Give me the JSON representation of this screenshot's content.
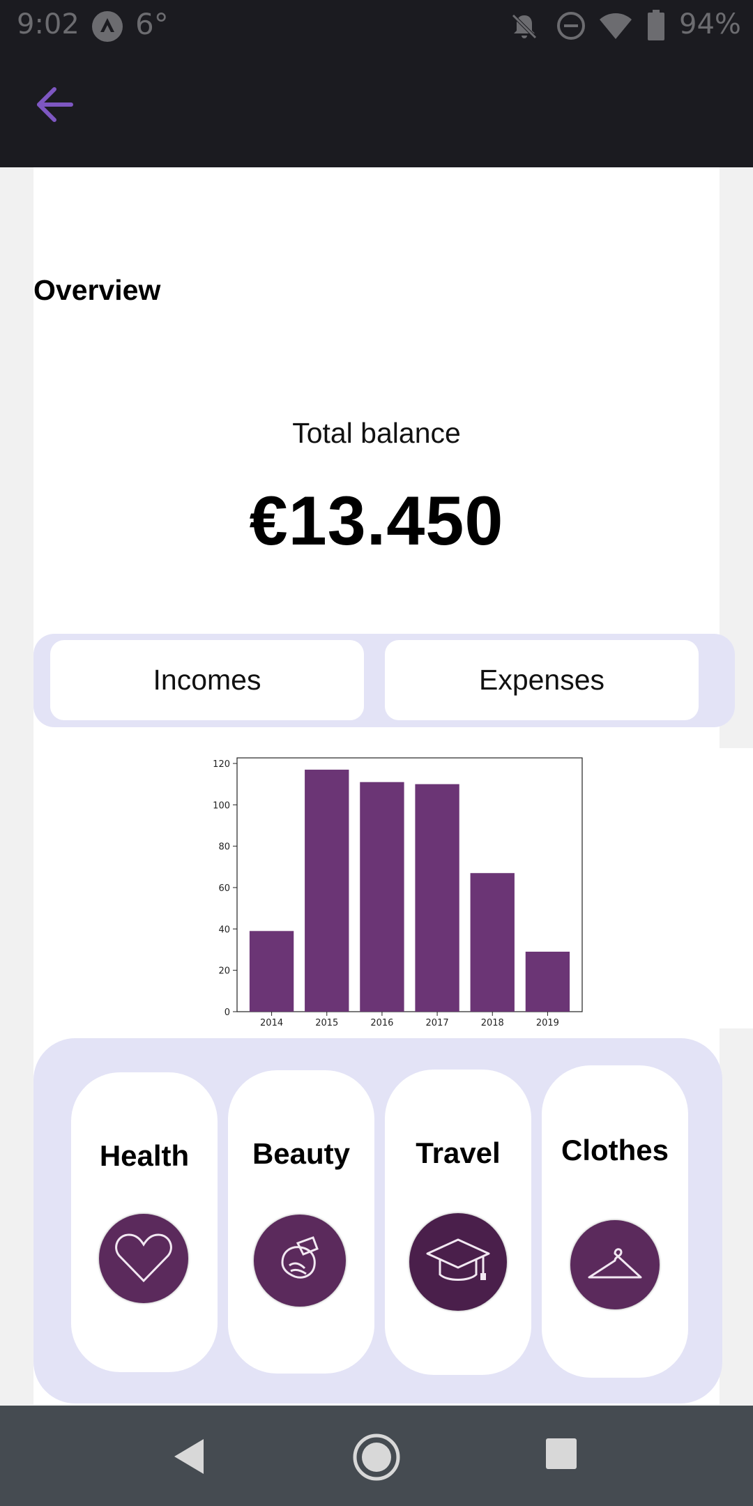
{
  "status_bar": {
    "time": "9:02",
    "temperature": "6°",
    "battery": "94%"
  },
  "toolbar": {
    "back_icon": "arrow-left-icon"
  },
  "overview": {
    "title": "Overview",
    "total_label": "Total balance",
    "total_value": "€13.450"
  },
  "tabs": {
    "incomes": "Incomes",
    "expenses": "Expenses"
  },
  "chart_data": {
    "type": "bar",
    "categories": [
      "2014",
      "2015",
      "2016",
      "2017",
      "2018",
      "2019"
    ],
    "values": [
      39,
      117,
      111,
      110,
      67,
      29
    ],
    "ylim": [
      0,
      120
    ],
    "yticks": [
      0,
      20,
      40,
      60,
      80,
      100,
      120
    ],
    "bar_color": "#6b3575",
    "title": "",
    "xlabel": "",
    "ylabel": ""
  },
  "categories": [
    {
      "label": "Health",
      "icon": "heart-icon"
    },
    {
      "label": "Beauty",
      "icon": "beauty-icon"
    },
    {
      "label": "Travel",
      "icon": "graduation-cap-icon"
    },
    {
      "label": "Clothes",
      "icon": "hanger-icon"
    }
  ],
  "colors": {
    "accent": "#7e57c2",
    "icon_bg": "#5b2a5c",
    "panel_bg": "#e3e3f6"
  }
}
